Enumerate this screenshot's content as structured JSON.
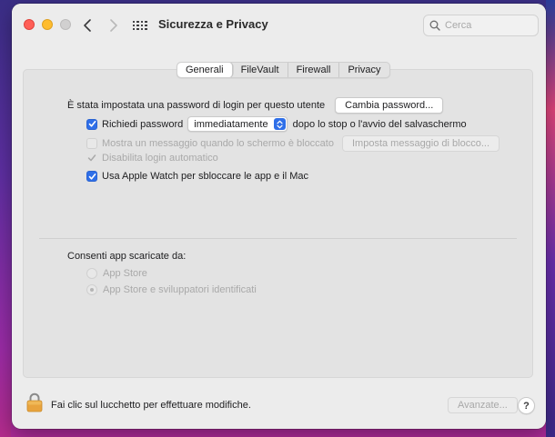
{
  "window": {
    "title": "Sicurezza e Privacy",
    "search_placeholder": "Cerca"
  },
  "tabs": [
    {
      "label": "Generali",
      "active": true
    },
    {
      "label": "FileVault",
      "active": false
    },
    {
      "label": "Firewall",
      "active": false
    },
    {
      "label": "Privacy",
      "active": false
    }
  ],
  "general": {
    "password_set_text": "È stata impostata una password di login per questo utente",
    "change_password_button": "Cambia password...",
    "require_password_label": "Richiedi password",
    "require_password_checked": true,
    "require_password_select": "immediatamente",
    "require_password_suffix": "dopo lo stop o l'avvio del salvaschermo",
    "show_message_label": "Mostra un messaggio quando lo schermo è bloccato",
    "show_message_checked": false,
    "set_message_button": "Imposta messaggio di blocco...",
    "disable_autologin_label": "Disabilita login automatico",
    "disable_autologin_checked": true,
    "apple_watch_label": "Usa Apple Watch per sbloccare le app e il Mac",
    "apple_watch_checked": true
  },
  "downloads": {
    "heading": "Consenti app scaricate da:",
    "options": [
      {
        "label": "App Store",
        "selected": false
      },
      {
        "label": "App Store e sviluppatori identificati",
        "selected": true
      }
    ]
  },
  "footer": {
    "lock_text": "Fai clic sul lucchetto per effettuare modifiche.",
    "advanced_button": "Avanzate...",
    "help_button": "?"
  },
  "colors": {
    "accent": "#2f6fe8",
    "close": "#ff5f57",
    "minimize": "#febc2e",
    "zoom_disabled": "#d1d0d0",
    "lock": "#e8a33d"
  }
}
